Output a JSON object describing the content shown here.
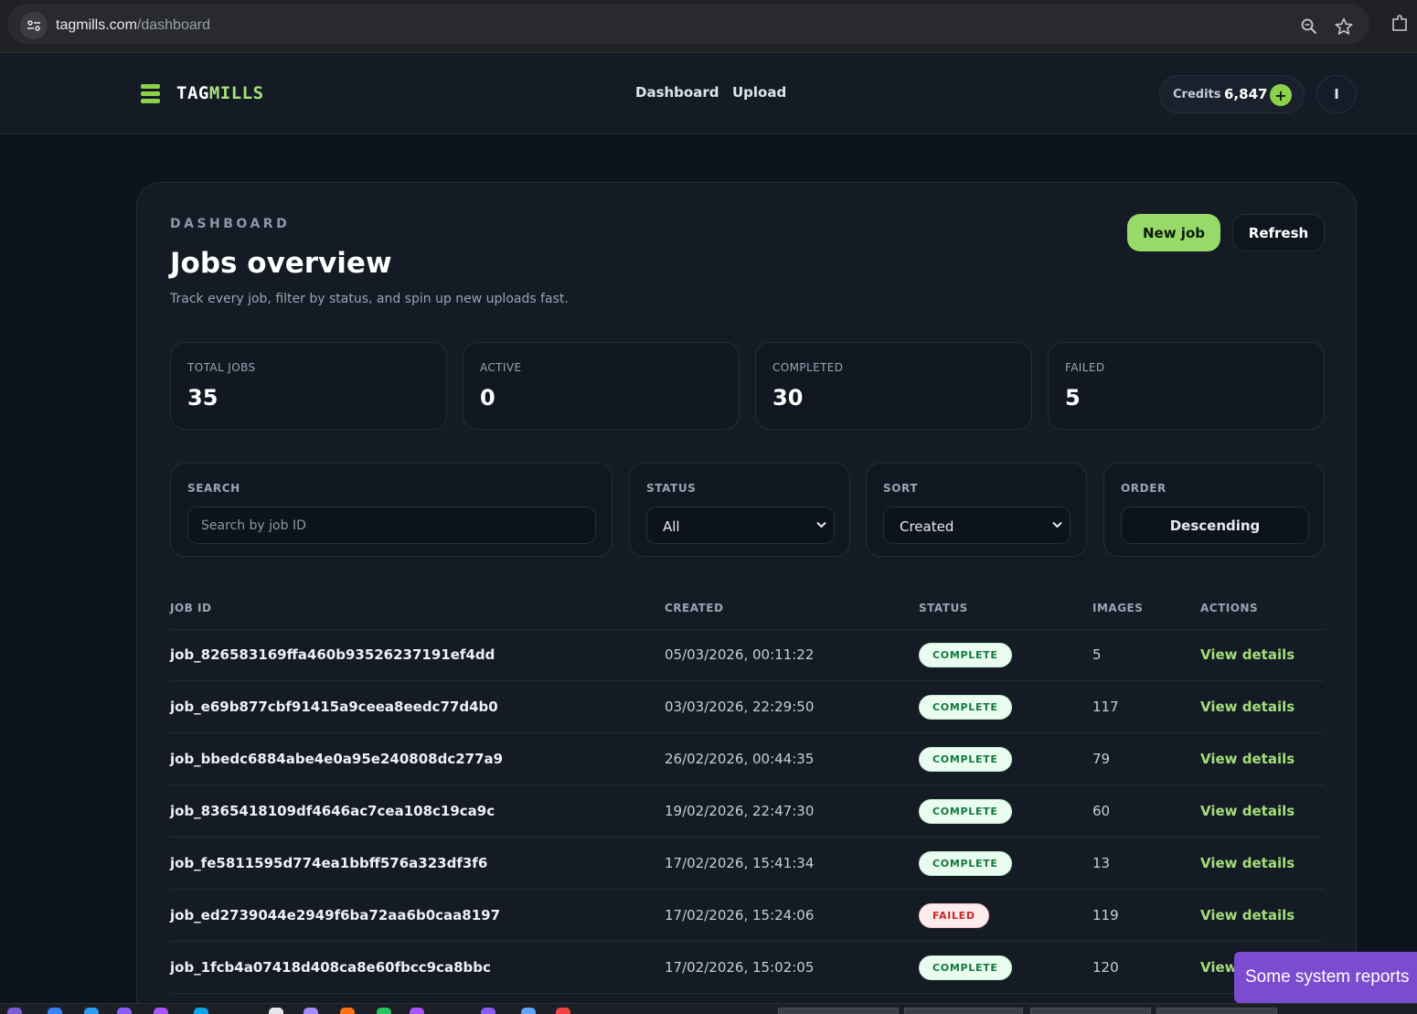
{
  "browser": {
    "url_host": "tagmills.com",
    "url_path": "/dashboard",
    "zoom_icon": "zoom-icon",
    "bookmark_icon": "star-icon",
    "extensions_icon": "extensions-icon"
  },
  "header": {
    "logo_part1": "TAG",
    "logo_part2": "MILLS",
    "nav": [
      "Dashboard",
      "Upload"
    ],
    "credits_label": "Credits",
    "credits_value": "6,847",
    "credits_add": "+",
    "avatar_initial": "I"
  },
  "page": {
    "eyebrow": "DASHBOARD",
    "title": "Jobs overview",
    "subtitle": "Track every job, filter by status, and spin up new uploads fast.",
    "new_job_label": "New job",
    "refresh_label": "Refresh"
  },
  "stats": [
    {
      "label": "TOTAL JOBS",
      "value": "35"
    },
    {
      "label": "ACTIVE",
      "value": "0"
    },
    {
      "label": "COMPLETED",
      "value": "30"
    },
    {
      "label": "FAILED",
      "value": "5"
    }
  ],
  "filters": {
    "search_label": "SEARCH",
    "search_placeholder": "Search by job ID",
    "search_value": "",
    "status_label": "STATUS",
    "status_value": "All",
    "sort_label": "SORT",
    "sort_value": "Created",
    "order_label": "ORDER",
    "order_value": "Descending"
  },
  "table": {
    "columns": [
      "JOB ID",
      "CREATED",
      "STATUS",
      "IMAGES",
      "ACTIONS"
    ],
    "rows": [
      {
        "id": "job_826583169ffa460b93526237191ef4dd",
        "created": "05/03/2026, 00:11:22",
        "status": "COMPLETE",
        "images": "5",
        "action": "View details"
      },
      {
        "id": "job_e69b877cbf91415a9ceea8eedc77d4b0",
        "created": "03/03/2026, 22:29:50",
        "status": "COMPLETE",
        "images": "117",
        "action": "View details"
      },
      {
        "id": "job_bbedc6884abe4e0a95e240808dc277a9",
        "created": "26/02/2026, 00:44:35",
        "status": "COMPLETE",
        "images": "79",
        "action": "View details"
      },
      {
        "id": "job_8365418109df4646ac7cea108c19ca9c",
        "created": "19/02/2026, 22:47:30",
        "status": "COMPLETE",
        "images": "60",
        "action": "View details"
      },
      {
        "id": "job_fe5811595d774ea1bbff576a323df3f6",
        "created": "17/02/2026, 15:41:34",
        "status": "COMPLETE",
        "images": "13",
        "action": "View details"
      },
      {
        "id": "job_ed2739044e2949f6ba72aa6b0caa8197",
        "created": "17/02/2026, 15:24:06",
        "status": "FAILED",
        "images": "119",
        "action": "View details"
      },
      {
        "id": "job_1fcb4a07418d408ca8e60fbcc9ca8bbc",
        "created": "17/02/2026, 15:02:05",
        "status": "COMPLETE",
        "images": "120",
        "action": "View details"
      }
    ]
  },
  "toast": {
    "text": "Some system reports "
  },
  "colors": {
    "accent": "#97da6a",
    "background": "#0e141d",
    "card": "#141b25",
    "complete": "#127a3e",
    "failed": "#c42a2a",
    "toast": "#7b4bd0"
  }
}
